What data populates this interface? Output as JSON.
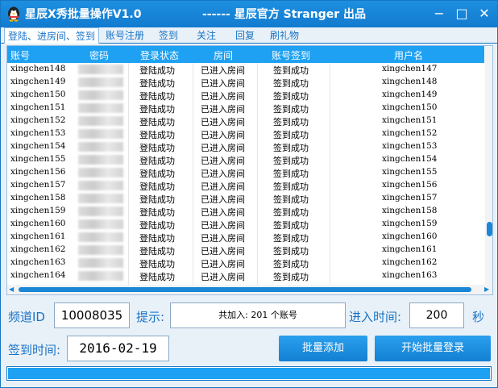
{
  "window": {
    "title": "星辰X秀批量操作V1.0",
    "subtitle": "------ 星辰官方 Stranger 出品",
    "minimize": "−",
    "maximize": "□",
    "close": "✕"
  },
  "menu": {
    "items": [
      "登陆、进房间、签到",
      "账号注册",
      "签到",
      "关注",
      "回复",
      "刷礼物"
    ]
  },
  "table": {
    "headers": [
      "账号",
      "密码",
      "登录状态",
      "房间",
      "账号签到",
      "用户名"
    ],
    "rows": [
      {
        "account": "xingchen148",
        "login": "登陆成功",
        "room": "已进入房间",
        "sign": "签到成功",
        "user": "xingchen147"
      },
      {
        "account": "xingchen149",
        "login": "登陆成功",
        "room": "已进入房间",
        "sign": "签到成功",
        "user": "xingchen148"
      },
      {
        "account": "xingchen150",
        "login": "登陆成功",
        "room": "已进入房间",
        "sign": "签到成功",
        "user": "xingchen149"
      },
      {
        "account": "xingchen151",
        "login": "登陆成功",
        "room": "已进入房间",
        "sign": "签到成功",
        "user": "xingchen150"
      },
      {
        "account": "xingchen152",
        "login": "登陆成功",
        "room": "已进入房间",
        "sign": "签到成功",
        "user": "xingchen151"
      },
      {
        "account": "xingchen153",
        "login": "登陆成功",
        "room": "已进入房间",
        "sign": "签到成功",
        "user": "xingchen152"
      },
      {
        "account": "xingchen154",
        "login": "登陆成功",
        "room": "已进入房间",
        "sign": "签到成功",
        "user": "xingchen153"
      },
      {
        "account": "xingchen155",
        "login": "登陆成功",
        "room": "已进入房间",
        "sign": "签到成功",
        "user": "xingchen154"
      },
      {
        "account": "xingchen156",
        "login": "登陆成功",
        "room": "已进入房间",
        "sign": "签到成功",
        "user": "xingchen155"
      },
      {
        "account": "xingchen157",
        "login": "登陆成功",
        "room": "已进入房间",
        "sign": "签到成功",
        "user": "xingchen156"
      },
      {
        "account": "xingchen158",
        "login": "登陆成功",
        "room": "已进入房间",
        "sign": "签到成功",
        "user": "xingchen157"
      },
      {
        "account": "xingchen159",
        "login": "登陆成功",
        "room": "已进入房间",
        "sign": "签到成功",
        "user": "xingchen158"
      },
      {
        "account": "xingchen160",
        "login": "登陆成功",
        "room": "已进入房间",
        "sign": "签到成功",
        "user": "xingchen159"
      },
      {
        "account": "xingchen161",
        "login": "登陆成功",
        "room": "已进入房间",
        "sign": "签到成功",
        "user": "xingchen160"
      },
      {
        "account": "xingchen162",
        "login": "登陆成功",
        "room": "已进入房间",
        "sign": "签到成功",
        "user": "xingchen161"
      },
      {
        "account": "xingchen163",
        "login": "登陆成功",
        "room": "已进入房间",
        "sign": "签到成功",
        "user": "xingchen162"
      },
      {
        "account": "xingchen164",
        "login": "登陆成功",
        "room": "已进入房间",
        "sign": "签到成功",
        "user": "xingchen163"
      }
    ]
  },
  "form": {
    "channel_label": "频道ID",
    "channel_value": "10008035",
    "hint_label": "提示:",
    "hint_value": "共加入: 201  个账号",
    "enter_time_label": "进入时间:",
    "enter_time_value": "200",
    "seconds_label": "秒",
    "sign_time_label": "签到时间:",
    "sign_time_value": "2016-02-19",
    "batch_button": "批量添加",
    "start_button": "开始批量登录"
  },
  "progress": {
    "value": 1.0
  },
  "colors": {
    "accent": "#1ea1f2",
    "label": "#1a73c5"
  },
  "icons": {
    "app": "qq-penguin-icon"
  }
}
